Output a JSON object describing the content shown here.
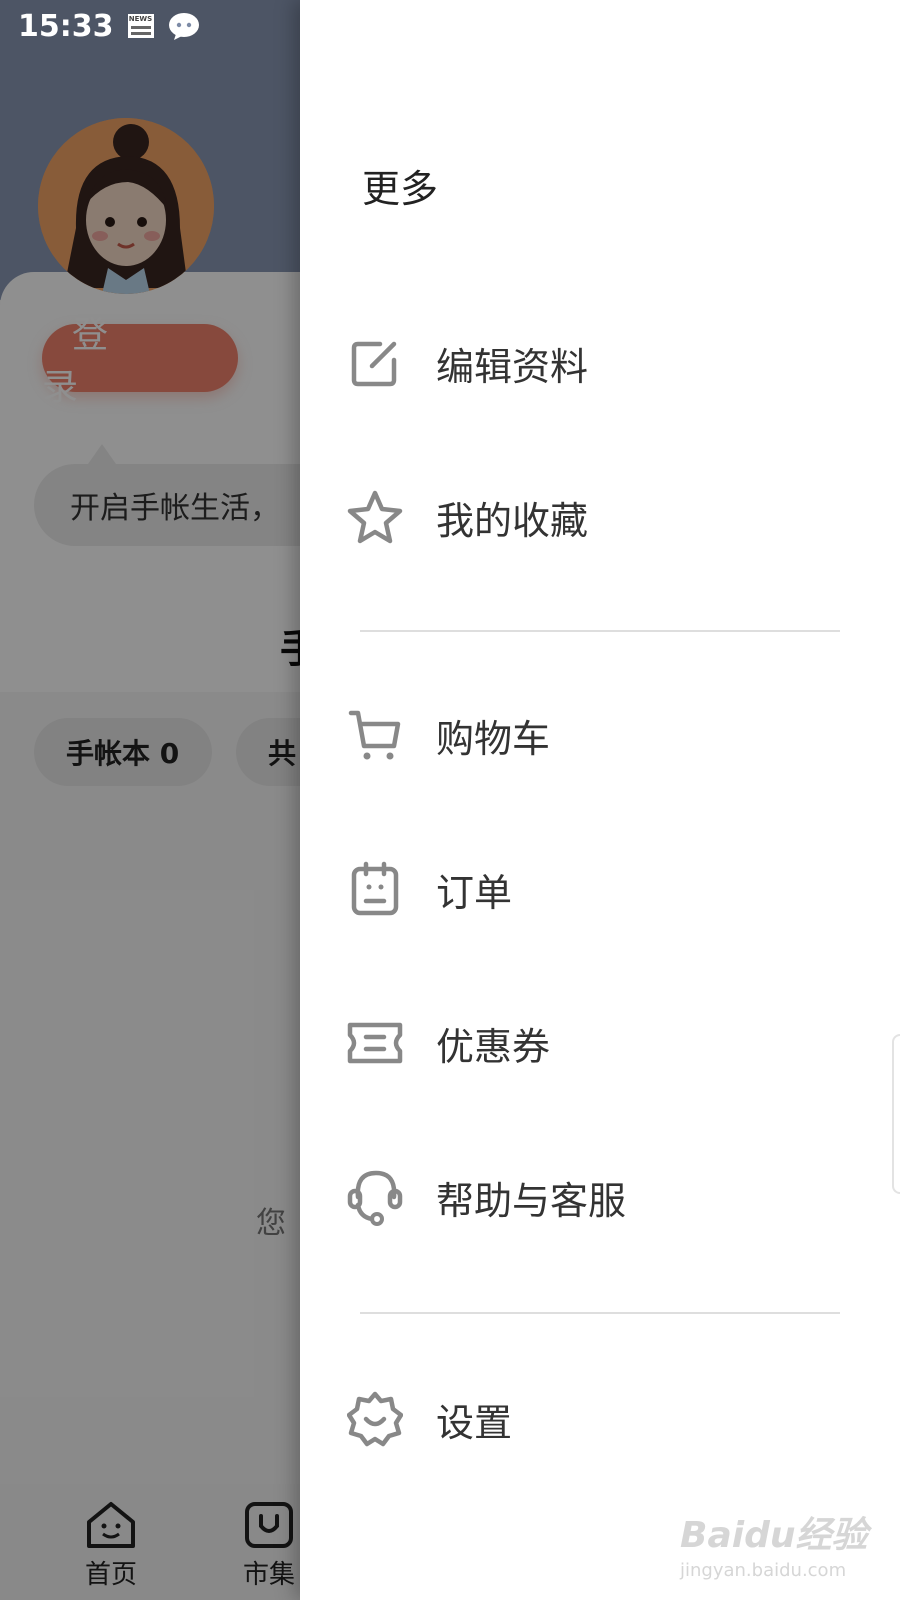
{
  "status_bar": {
    "time": "15:33",
    "news_label": "NEWS"
  },
  "background_app": {
    "login_button": "登 录",
    "tip_text": "开启手帐生活，",
    "section_title_partial": "手",
    "pills": [
      "手帐本 0",
      "共"
    ],
    "empty_text_partial": "您",
    "tabs": [
      {
        "label": "首页",
        "icon": "home-smile-icon"
      },
      {
        "label": "市集",
        "icon": "market-icon"
      }
    ]
  },
  "drawer": {
    "title": "更多",
    "items": [
      {
        "label": "编辑资料",
        "icon": "edit-icon"
      },
      {
        "label": "我的收藏",
        "icon": "star-icon"
      },
      {
        "label": "购物车",
        "icon": "cart-icon"
      },
      {
        "label": "订单",
        "icon": "order-icon"
      },
      {
        "label": "优惠券",
        "icon": "coupon-icon"
      },
      {
        "label": "帮助与客服",
        "icon": "headset-icon"
      },
      {
        "label": "设置",
        "icon": "settings-icon"
      }
    ]
  },
  "watermark": {
    "main": "Baidu经验",
    "sub": "jingyan.baidu.com"
  },
  "colors": {
    "icon_gray": "#888888",
    "login_button": "#f0826e",
    "header_bg": "#8a98b4"
  }
}
